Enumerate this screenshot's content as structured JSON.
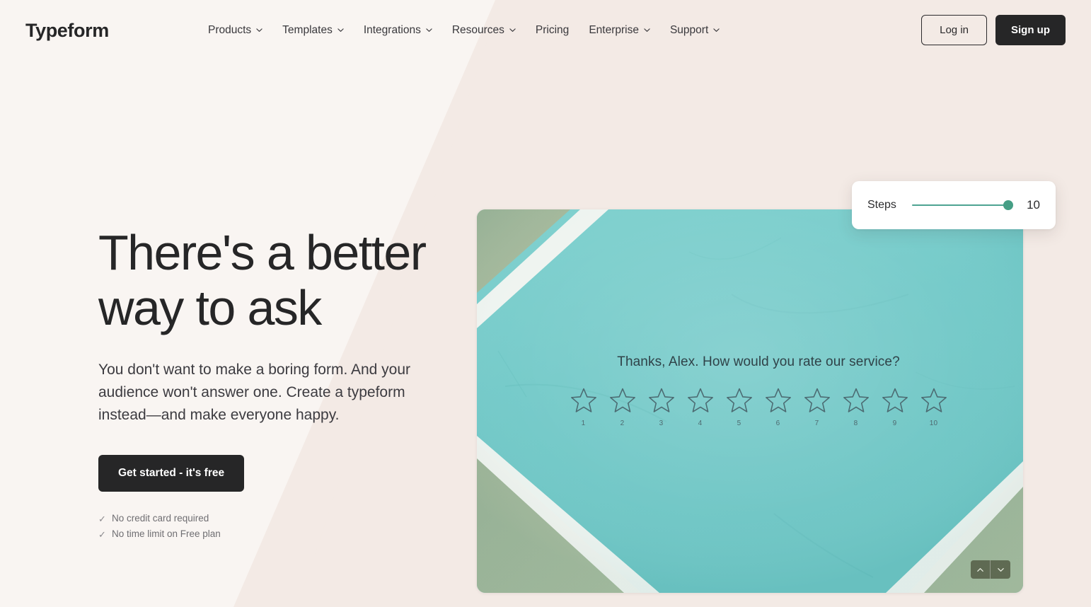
{
  "brand": {
    "logo_text": "Typeform",
    "accent_teal": "#459e85",
    "ink": "#262627",
    "bg_cream": "#f9f5f2",
    "bg_blush": "#f3eae5"
  },
  "header": {
    "nav_items": [
      {
        "label": "Products",
        "has_caret": true,
        "icon": "chevron-down-icon"
      },
      {
        "label": "Templates",
        "has_caret": true,
        "icon": "chevron-down-icon"
      },
      {
        "label": "Integrations",
        "has_caret": true,
        "icon": "chevron-down-icon"
      },
      {
        "label": "Resources",
        "has_caret": true,
        "icon": "chevron-down-icon"
      },
      {
        "label": "Pricing",
        "has_caret": false,
        "icon": ""
      },
      {
        "label": "Enterprise",
        "has_caret": true,
        "icon": "chevron-down-icon"
      },
      {
        "label": "Support",
        "has_caret": true,
        "icon": "chevron-down-icon"
      }
    ],
    "login_label": "Log in",
    "signup_label": "Sign up"
  },
  "hero": {
    "title": "There's a better\nway to ask",
    "subtitle": "You don't want to make a boring form. And your audience won't answer one. Create a typeform instead—and make everyone happy.",
    "cta_label": "Get started - it's free",
    "perks": [
      {
        "check": "✓",
        "text": "No credit card required"
      },
      {
        "check": "✓",
        "text": "No time limit on Free plan"
      }
    ]
  },
  "preview": {
    "question": "Thanks, Alex. How would you rate our service?",
    "rating_scale": [
      "1",
      "2",
      "3",
      "4",
      "5",
      "6",
      "7",
      "8",
      "9",
      "10"
    ],
    "star_icon": "star-outline-icon",
    "pager": {
      "up_icon": "chevron-up-icon",
      "down_icon": "chevron-down-icon"
    }
  },
  "steps_card": {
    "label": "Steps",
    "value": "10",
    "slider_icon": "slider-thumb-icon"
  }
}
